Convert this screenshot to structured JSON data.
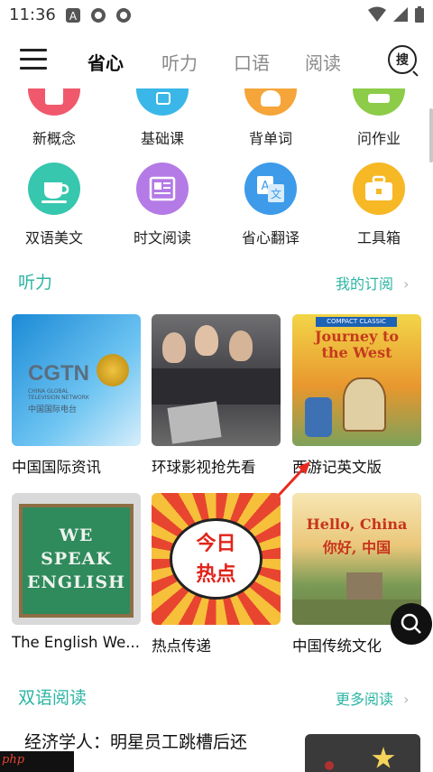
{
  "status_bar": {
    "time": "11:36",
    "left_icons": [
      "text-a-icon",
      "app-icon",
      "app-icon"
    ],
    "right_icons": [
      "wifi-icon",
      "signal-icon",
      "battery-icon"
    ]
  },
  "header": {
    "tabs": [
      {
        "label": "省心",
        "active": true
      },
      {
        "label": "听力",
        "active": false
      },
      {
        "label": "口语",
        "active": false
      },
      {
        "label": "阅读",
        "active": false
      }
    ],
    "search_label": "搜"
  },
  "quick_grid": {
    "row1": [
      {
        "label": "新概念",
        "color": "#f0596c",
        "icon": "book-icon"
      },
      {
        "label": "基础课",
        "color": "#3ab7e8",
        "icon": "alphabet-icon"
      },
      {
        "label": "背单词",
        "color": "#f5a53a",
        "icon": "brain-icon"
      },
      {
        "label": "问作业",
        "color": "#8ccc48",
        "icon": "homework-icon"
      }
    ],
    "row2": [
      {
        "label": "双语美文",
        "color": "#36c7ae",
        "icon": "coffee-cup-icon"
      },
      {
        "label": "时文阅读",
        "color": "#b47ae6",
        "icon": "newspaper-icon"
      },
      {
        "label": "省心翻译",
        "color": "#3d9be9",
        "icon": "translate-icon"
      },
      {
        "label": "工具箱",
        "color": "#f6b825",
        "icon": "toolbox-icon"
      }
    ]
  },
  "listening": {
    "title": "听力",
    "more": "我的订阅",
    "cards": [
      {
        "title": "中国国际资讯",
        "img": "cgtn-logo",
        "img_text": "CGTN",
        "img_sub": "CHINA GLOBAL\nTELEVISION NETWORK",
        "img_cn": "中国国际电台"
      },
      {
        "title": "环球影视抢先看",
        "img": "movie-poster",
        "img_text": "",
        "img_sub": "",
        "img_cn": ""
      },
      {
        "title": "西游记英文版",
        "img": "journey-to-the-west-cover",
        "img_text": "Journey to the West",
        "img_sub": "COMPACT CLASSIC",
        "img_cn": ""
      }
    ],
    "cards2": [
      {
        "title": "The English We...",
        "img": "chalkboard",
        "img_text": "WE\nSPEAK\nENGLISH"
      },
      {
        "title": "热点传递",
        "img": "hot-news",
        "img_text": "今日\n热点"
      },
      {
        "title": "中国传统文化",
        "img": "great-wall",
        "img_text": "Hello, China\n你好, 中国"
      }
    ]
  },
  "bilingual": {
    "title": "双语阅读",
    "more": "更多阅读",
    "article_title": "经济学人：明星员工跳槽后还"
  },
  "badge": "php"
}
